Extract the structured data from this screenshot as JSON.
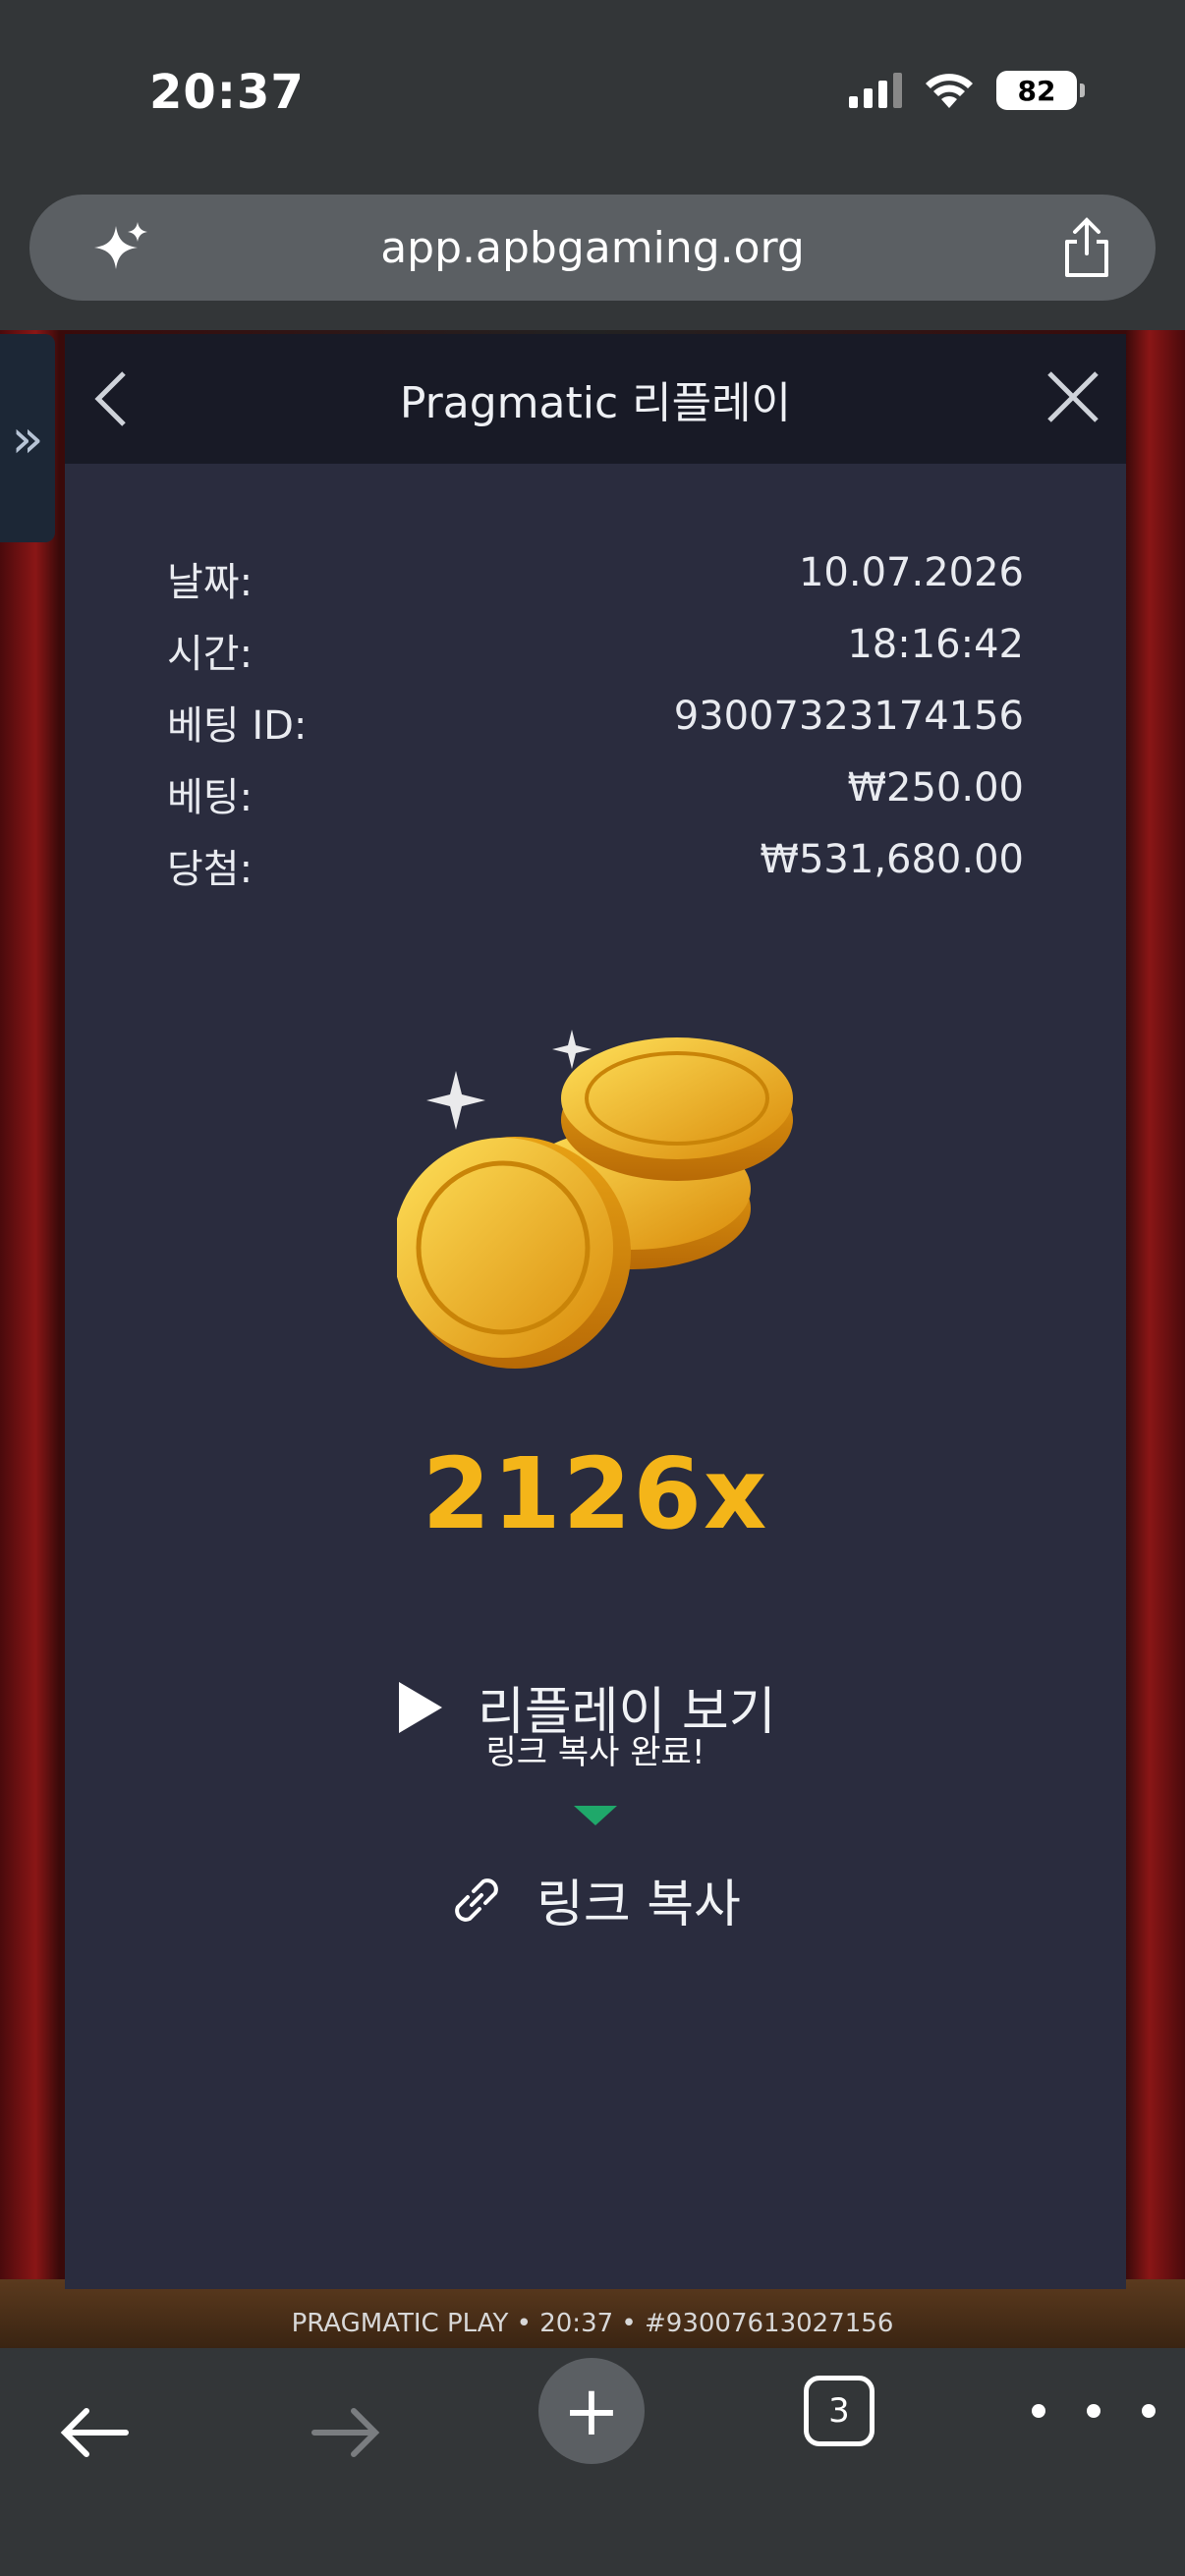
{
  "status_bar": {
    "time": "20:37",
    "battery": "82"
  },
  "browser": {
    "url": "app.apbgaming.org",
    "tab_count": "3"
  },
  "modal": {
    "title": "Pragmatic 리플레이",
    "info": [
      {
        "label": "날짜:",
        "value": "10.07.2026"
      },
      {
        "label": "시간:",
        "value": "18:16:42"
      },
      {
        "label": "베팅 ID:",
        "value": "93007323174156"
      },
      {
        "label": "베팅:",
        "value": "₩250.00"
      },
      {
        "label": "당첨:",
        "value": "₩531,680.00"
      }
    ],
    "multiplier": "2126x",
    "replay_label": "리플레이 보기",
    "tooltip": "링크 복사 완료!",
    "copy_label": "링크 복사"
  },
  "game_footer": "PRAGMATIC PLAY • 20:37 • #93007613027156",
  "colors": {
    "accent": "#f4b519",
    "tooltip_arrow": "#1fa86a",
    "modal_bg": "#2a2c3e"
  }
}
